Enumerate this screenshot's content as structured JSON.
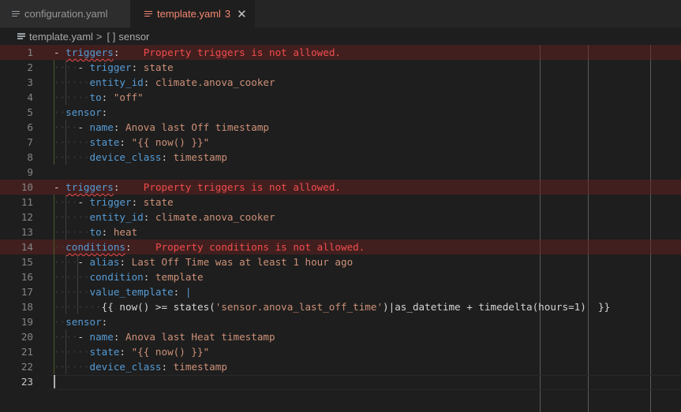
{
  "tabs": [
    {
      "label": "configuration.yaml",
      "icon": "file-lines-icon",
      "active": false
    },
    {
      "label": "template.yaml",
      "icon": "file-lines-icon",
      "active": true,
      "problem_count": "3",
      "close": "✕"
    }
  ],
  "breadcrumb": {
    "file": "template.yaml",
    "separator": ">",
    "symbol_icon": "[ ]",
    "symbol": "sensor"
  },
  "colors": {
    "error": "#f14c4c",
    "key": "#569cd6",
    "string": "#ce9178",
    "error_line_bg": "#4b2020"
  },
  "editor": {
    "current_line": "23",
    "lines": [
      {
        "num": "1",
        "err": true,
        "tokens": [
          [
            "p",
            "- "
          ],
          [
            "k sq",
            "triggers"
          ],
          [
            "p",
            ":"
          ],
          [
            "ws",
            "    "
          ],
          [
            "e",
            "Property triggers is not allowed."
          ]
        ]
      },
      {
        "num": "2",
        "tokens": [
          [
            "ws",
            "····"
          ],
          [
            "p",
            "- "
          ],
          [
            "k",
            "trigger"
          ],
          [
            "p",
            ": "
          ],
          [
            "s",
            "state"
          ]
        ]
      },
      {
        "num": "3",
        "tokens": [
          [
            "ws",
            "······"
          ],
          [
            "k",
            "entity_id"
          ],
          [
            "p",
            ": "
          ],
          [
            "s",
            "climate.anova_cooker"
          ]
        ]
      },
      {
        "num": "4",
        "tokens": [
          [
            "ws",
            "······"
          ],
          [
            "k",
            "to"
          ],
          [
            "p",
            ": "
          ],
          [
            "s",
            "\"off\""
          ]
        ]
      },
      {
        "num": "5",
        "tokens": [
          [
            "ws",
            "··"
          ],
          [
            "k",
            "sensor"
          ],
          [
            "p",
            ":"
          ]
        ]
      },
      {
        "num": "6",
        "tokens": [
          [
            "ws",
            "····"
          ],
          [
            "p",
            "- "
          ],
          [
            "k",
            "name"
          ],
          [
            "p",
            ": "
          ],
          [
            "s",
            "Anova last Off timestamp"
          ]
        ]
      },
      {
        "num": "7",
        "tokens": [
          [
            "ws",
            "······"
          ],
          [
            "k",
            "state"
          ],
          [
            "p",
            ": "
          ],
          [
            "s",
            "\"{{ now() }}\""
          ]
        ]
      },
      {
        "num": "8",
        "tokens": [
          [
            "ws",
            "······"
          ],
          [
            "k",
            "device_class"
          ],
          [
            "p",
            ": "
          ],
          [
            "s",
            "timestamp"
          ]
        ]
      },
      {
        "num": "9",
        "tokens": []
      },
      {
        "num": "10",
        "err": true,
        "tokens": [
          [
            "p",
            "- "
          ],
          [
            "k sq",
            "triggers"
          ],
          [
            "p",
            ":"
          ],
          [
            "ws",
            "    "
          ],
          [
            "e",
            "Property triggers is not allowed."
          ]
        ]
      },
      {
        "num": "11",
        "tokens": [
          [
            "ws",
            "····"
          ],
          [
            "p",
            "- "
          ],
          [
            "k",
            "trigger"
          ],
          [
            "p",
            ": "
          ],
          [
            "s",
            "state"
          ]
        ]
      },
      {
        "num": "12",
        "tokens": [
          [
            "ws",
            "······"
          ],
          [
            "k",
            "entity_id"
          ],
          [
            "p",
            ": "
          ],
          [
            "s",
            "climate.anova_cooker"
          ]
        ]
      },
      {
        "num": "13",
        "tokens": [
          [
            "ws",
            "······"
          ],
          [
            "k",
            "to"
          ],
          [
            "p",
            ": "
          ],
          [
            "s",
            "heat"
          ]
        ]
      },
      {
        "num": "14",
        "err": true,
        "tokens": [
          [
            "ws",
            "··"
          ],
          [
            "k sq",
            "conditions"
          ],
          [
            "p",
            ":"
          ],
          [
            "ws",
            "    "
          ],
          [
            "e",
            "Property conditions is not allowed."
          ]
        ]
      },
      {
        "num": "15",
        "tokens": [
          [
            "ws",
            "····"
          ],
          [
            "p",
            "- "
          ],
          [
            "k",
            "alias"
          ],
          [
            "p",
            ": "
          ],
          [
            "s",
            "Last Off Time was at least 1 hour ago"
          ]
        ]
      },
      {
        "num": "16",
        "tokens": [
          [
            "ws",
            "······"
          ],
          [
            "k",
            "condition"
          ],
          [
            "p",
            ": "
          ],
          [
            "s",
            "template"
          ]
        ]
      },
      {
        "num": "17",
        "tokens": [
          [
            "ws",
            "······"
          ],
          [
            "k",
            "value_template"
          ],
          [
            "p",
            ": "
          ],
          [
            "bar",
            "|"
          ]
        ]
      },
      {
        "num": "18",
        "tokens": [
          [
            "ws",
            "········"
          ],
          [
            "p",
            "{{ now() >= states("
          ],
          [
            "s",
            "'sensor.anova_last_off_time'"
          ],
          [
            "p",
            ")|as_datetime + timedelta(hours=1)  }}"
          ]
        ]
      },
      {
        "num": "19",
        "tokens": [
          [
            "ws",
            "··"
          ],
          [
            "k",
            "sensor"
          ],
          [
            "p",
            ":"
          ]
        ]
      },
      {
        "num": "20",
        "tokens": [
          [
            "ws",
            "····"
          ],
          [
            "p",
            "- "
          ],
          [
            "k",
            "name"
          ],
          [
            "p",
            ": "
          ],
          [
            "s",
            "Anova last Heat timestamp"
          ]
        ]
      },
      {
        "num": "21",
        "tokens": [
          [
            "ws",
            "······"
          ],
          [
            "k",
            "state"
          ],
          [
            "p",
            ": "
          ],
          [
            "s",
            "\"{{ now() }}\""
          ]
        ]
      },
      {
        "num": "22",
        "tokens": [
          [
            "ws",
            "······"
          ],
          [
            "k",
            "device_class"
          ],
          [
            "p",
            ": "
          ],
          [
            "s",
            "timestamp"
          ]
        ]
      },
      {
        "num": "23",
        "tokens": []
      }
    ]
  }
}
